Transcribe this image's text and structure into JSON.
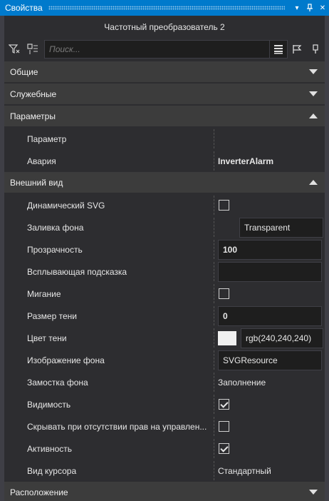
{
  "window": {
    "title": "Свойства"
  },
  "object_name": "Частотный преобразователь 2",
  "search": {
    "placeholder": "Поиск..."
  },
  "categories": {
    "general": {
      "label": "Общие"
    },
    "service": {
      "label": "Служебные"
    },
    "params": {
      "label": "Параметры"
    },
    "appearance": {
      "label": "Внешний вид"
    },
    "location": {
      "label": "Расположение"
    }
  },
  "params_rows": [
    {
      "name": "Параметр",
      "value": ""
    },
    {
      "name": "Авария",
      "value": "InverterAlarm"
    }
  ],
  "appearance_rows": {
    "dynamic_svg": {
      "name": "Динамический SVG",
      "checked": false
    },
    "fill": {
      "name": "Заливка фона",
      "value": "Transparent"
    },
    "opacity": {
      "name": "Прозрачность",
      "value": "100"
    },
    "tooltip": {
      "name": "Всплывающая подсказка",
      "value": ""
    },
    "blink": {
      "name": "Мигание",
      "checked": false
    },
    "shadow_size": {
      "name": "Размер тени",
      "value": "0"
    },
    "shadow_color": {
      "name": "Цвет тени",
      "value": "rgb(240,240,240)",
      "swatch": "#f0f0f0"
    },
    "bg_image": {
      "name": "Изображение фона",
      "value": "SVGResource"
    },
    "bg_tiling": {
      "name": "Замостка фона",
      "value": "Заполнение"
    },
    "visibility": {
      "name": "Видимость",
      "checked": true
    },
    "hide_no_rights": {
      "name": "Скрывать при отсутствии прав на управлен...",
      "checked": false
    },
    "active": {
      "name": "Активность",
      "checked": true
    },
    "cursor": {
      "name": "Вид курсора",
      "value": "Стандартный"
    }
  },
  "colors": {
    "accent": "#007acc",
    "panel": "#2d2d30",
    "category": "#3c3c3c",
    "field": "#1e1e1e"
  }
}
